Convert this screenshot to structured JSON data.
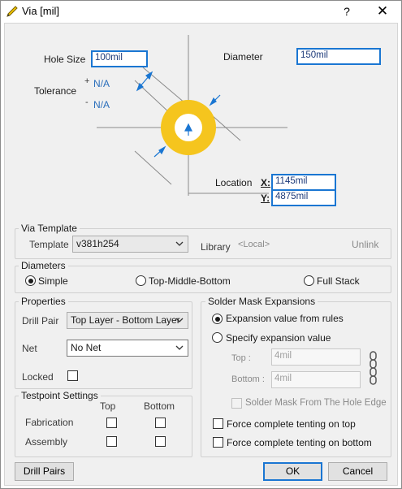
{
  "window": {
    "title": "Via [mil]",
    "help_label": "?",
    "close_label": "✕"
  },
  "top": {
    "hole_size_label": "Hole Size",
    "hole_size_value": "100mil",
    "tolerance_label": "Tolerance",
    "tol_plus_sign": "+",
    "tol_plus_value": "N/A",
    "tol_minus_sign": "-",
    "tol_minus_value": "N/A",
    "diameter_label": "Diameter",
    "diameter_value": "150mil",
    "location_label": "Location",
    "x_label": "X:",
    "x_value": "1145mil",
    "y_label": "Y:",
    "y_value": "4875mil"
  },
  "via_template": {
    "group_title": "Via Template",
    "template_label": "Template",
    "template_value": "v381h254",
    "library_label": "Library",
    "library_value": "<Local>",
    "unlink_label": "Unlink"
  },
  "diameters": {
    "group_title": "Diameters",
    "options": [
      "Simple",
      "Top-Middle-Bottom",
      "Full Stack"
    ],
    "selected": "Simple"
  },
  "properties": {
    "group_title": "Properties",
    "drill_pair_label": "Drill Pair",
    "drill_pair_value": "Top Layer - Bottom Layer",
    "net_label": "Net",
    "net_value": "No Net",
    "locked_label": "Locked"
  },
  "testpoint": {
    "group_title": "Testpoint Settings",
    "col_top": "Top",
    "col_bottom": "Bottom",
    "row_fabrication": "Fabrication",
    "row_assembly": "Assembly"
  },
  "solder_mask": {
    "group_title": "Solder Mask Expansions",
    "opt_rules": "Expansion value from rules",
    "opt_specify": "Specify expansion value",
    "top_label": "Top :",
    "top_value": "4mil",
    "bottom_label": "Bottom :",
    "bottom_value": "4mil",
    "hole_edge_label": "Solder Mask From The Hole Edge",
    "tent_top_label": "Force complete tenting on top",
    "tent_bottom_label": "Force complete tenting on bottom"
  },
  "buttons": {
    "drill_pairs": "Drill Pairs",
    "ok": "OK",
    "cancel": "Cancel"
  },
  "colors": {
    "accent": "#1a76d2",
    "pad": "#f5c51e",
    "hole": "#ffffff",
    "link_text": "#2a6ebb"
  }
}
